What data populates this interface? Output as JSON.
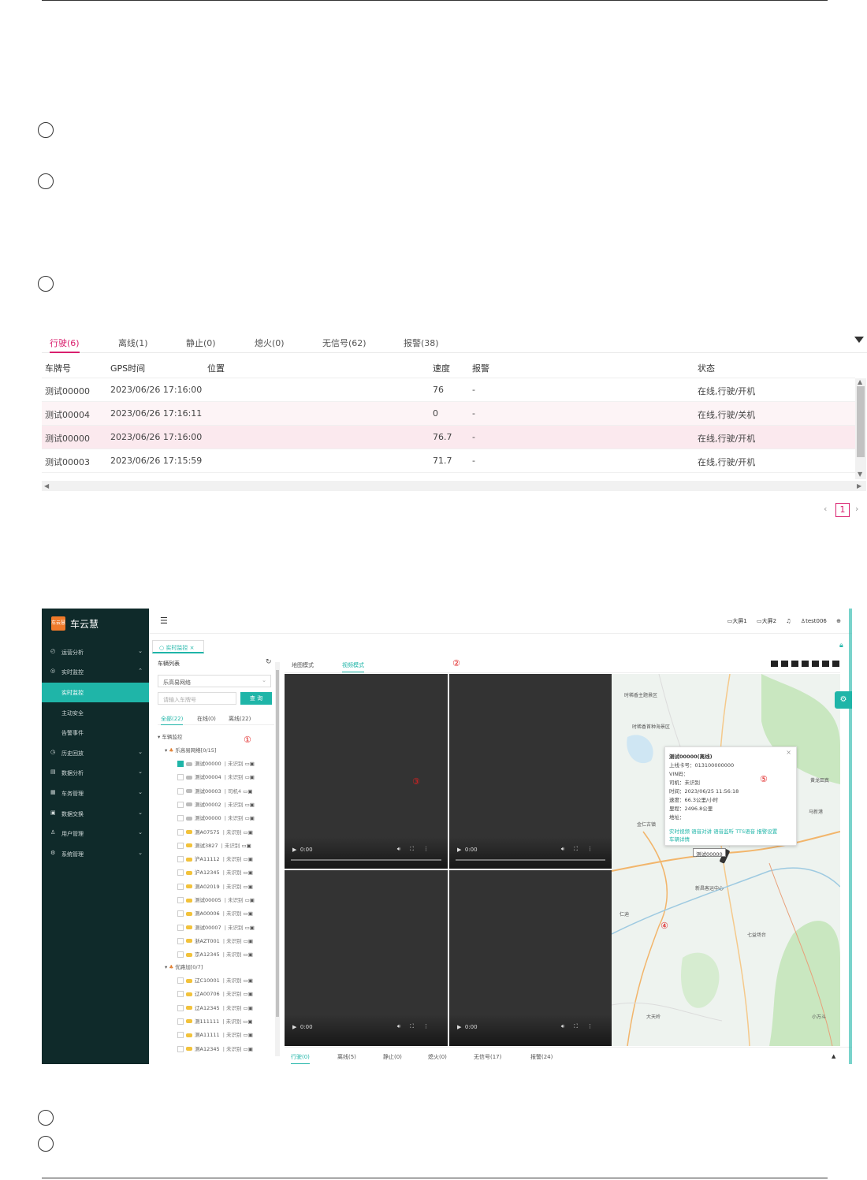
{
  "status_table": {
    "tabs": [
      "行驶(6)",
      "离线(1)",
      "静止(0)",
      "熄火(0)",
      "无信号(62)",
      "报警(38)"
    ],
    "columns": [
      "车牌号",
      "GPS时间",
      "位置",
      "速度",
      "报警",
      "状态"
    ],
    "rows": [
      {
        "plate": "测试00000",
        "time": "2023/06/26 17:16:00",
        "speed": "76",
        "alarm": "-",
        "status": "在线,行驶/开机"
      },
      {
        "plate": "测试00004",
        "time": "2023/06/26 17:16:11",
        "speed": "0",
        "alarm": "-",
        "status": "在线,行驶/关机"
      },
      {
        "plate": "测试00000",
        "time": "2023/06/26 17:16:00",
        "speed": "76.7",
        "alarm": "-",
        "status": "在线,行驶/开机"
      },
      {
        "plate": "测试00003",
        "time": "2023/06/26 17:15:59",
        "speed": "71.7",
        "alarm": "-",
        "status": "在线,行驶/开机"
      }
    ],
    "pager": {
      "prev": "‹",
      "page": "1",
      "next": "›"
    }
  },
  "app": {
    "brand": "车云慧",
    "logo_text": "车云慧",
    "nav": [
      {
        "label": "运营分析",
        "icon": "◴"
      },
      {
        "label": "实时监控",
        "icon": "◎"
      },
      {
        "label": "实时监控",
        "icon": ""
      },
      {
        "label": "主动安全",
        "icon": ""
      },
      {
        "label": "告警事件",
        "icon": ""
      },
      {
        "label": "历史回放",
        "icon": "◷"
      },
      {
        "label": "数据分析",
        "icon": "▤"
      },
      {
        "label": "车务管理",
        "icon": "▦"
      },
      {
        "label": "数据交换",
        "icon": "▣"
      },
      {
        "label": "用户管理",
        "icon": "♙"
      },
      {
        "label": "系统管理",
        "icon": "⚙"
      }
    ],
    "topbar": {
      "screen1": "大屏1",
      "screen2": "大屏2",
      "bell": "🔔",
      "user": "test006",
      "globe": "🌐"
    },
    "page_tab": "实时监控",
    "vehicle_panel": {
      "title": "车辆列表",
      "select_value": "乐高易网络",
      "search_placeholder": "请输入车牌号",
      "search_button": "查 询",
      "tabs": [
        "全部(22)",
        "在线(0)",
        "离线(22)"
      ],
      "root": "车辆监控",
      "group1": "乐高易网络[0/15]",
      "group2": "优路加[0/7]",
      "group1_items": [
        {
          "name": "测试00000",
          "tail": "| 未识别",
          "car": "g",
          "checked": true
        },
        {
          "name": "测试00004",
          "tail": "| 未识别",
          "car": "g",
          "checked": false
        },
        {
          "name": "测试00003",
          "tail": "| 司机4",
          "car": "g",
          "checked": false
        },
        {
          "name": "测试00002",
          "tail": "| 未识别",
          "car": "g",
          "checked": false
        },
        {
          "name": "测试00000",
          "tail": "| 未识别",
          "car": "g",
          "checked": false
        },
        {
          "name": "测A07575",
          "tail": "| 未识别",
          "car": "y",
          "checked": false
        },
        {
          "name": "测试3827",
          "tail": "| 未识别",
          "car": "y",
          "checked": false
        },
        {
          "name": "沪A11112",
          "tail": "| 未识别",
          "car": "y",
          "checked": false
        },
        {
          "name": "沪A12345",
          "tail": "| 未识别",
          "car": "y",
          "checked": false
        },
        {
          "name": "测A02019",
          "tail": "| 未识别",
          "car": "y",
          "checked": false
        },
        {
          "name": "测试00005",
          "tail": "| 未识别",
          "car": "y",
          "checked": false
        },
        {
          "name": "测A00006",
          "tail": "| 未识别",
          "car": "y",
          "checked": false
        },
        {
          "name": "测试00007",
          "tail": "| 未识别",
          "car": "y",
          "checked": false
        },
        {
          "name": "浙AZT001",
          "tail": "| 未识别",
          "car": "y",
          "checked": false
        },
        {
          "name": "京A12345",
          "tail": "| 未识别",
          "car": "y",
          "checked": false
        }
      ],
      "group2_items": [
        {
          "name": "辽C10001",
          "tail": "| 未识别",
          "car": "y",
          "checked": false
        },
        {
          "name": "辽A00706",
          "tail": "| 未识别",
          "car": "y",
          "checked": false
        },
        {
          "name": "辽A12345",
          "tail": "| 未识别",
          "car": "y",
          "checked": false
        },
        {
          "name": "测111111",
          "tail": "| 未识别",
          "car": "y",
          "checked": false
        },
        {
          "name": "测A11111",
          "tail": "| 未识别",
          "car": "y",
          "checked": false
        },
        {
          "name": "测A12345",
          "tail": "| 未识别",
          "car": "y",
          "checked": false
        }
      ]
    },
    "modes": [
      "地图模式",
      "视频模式"
    ],
    "video_time": "0:00",
    "popup": {
      "title": "测试00000(离线)",
      "sim": "上线卡号：013100000000",
      "vin": "VIN码：",
      "driver": "司机：未识别",
      "time": "时间：2023/06/25 11:56:18",
      "speed": "速度：66.3公里/小时",
      "mileage": "里程：2496.8公里",
      "address": "地址：",
      "links": "实时视频 语音对讲 语音监听 TTS语音 报警设置",
      "detail": "车辆详情"
    },
    "pin_label": "测试00000",
    "map_labels": [
      "时稀香主题景区",
      "时稀香首种海景区",
      "黄龙田真",
      "马新港",
      "新昌客运中心",
      "仁迪",
      "七益场台",
      "大天岭",
      "小万斗",
      "金仁古镇"
    ],
    "bottom_tabs": [
      "行驶(0)",
      "离线(5)",
      "静止(0)",
      "熄火(0)",
      "无信号(17)",
      "报警(24)"
    ],
    "markers": [
      "①",
      "②",
      "③",
      "④",
      "⑤"
    ]
  }
}
